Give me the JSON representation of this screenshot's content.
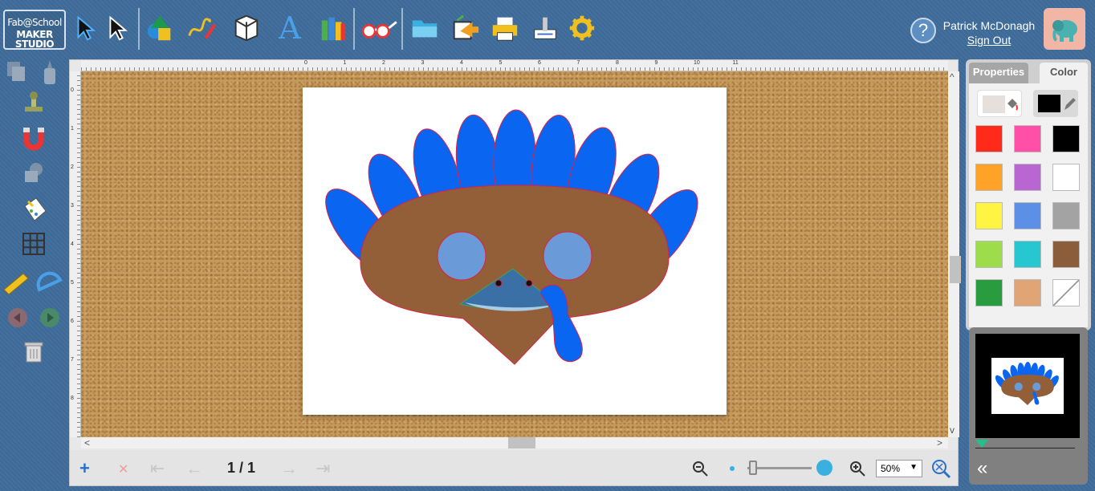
{
  "app": {
    "logo_line1": "Fab@School",
    "logo_line2": "MAKER STUDIO"
  },
  "toolbar": {
    "tools": [
      {
        "name": "select-tool",
        "icon": "arrow-cursor-icon"
      },
      {
        "name": "direct-select-tool",
        "icon": "arrow-outline-icon"
      },
      {
        "name": "shapes-tool",
        "icon": "shapes-icon"
      },
      {
        "name": "draw-tool",
        "icon": "pencil-line-icon"
      },
      {
        "name": "3d-tool",
        "icon": "3d-box-icon"
      },
      {
        "name": "text-tool",
        "icon": "letter-a-icon"
      },
      {
        "name": "library-tool",
        "icon": "books-icon"
      },
      {
        "name": "glasses-tool",
        "icon": "glasses-icon"
      },
      {
        "name": "open-tool",
        "icon": "folder-icon"
      },
      {
        "name": "export-tool",
        "icon": "export-icon"
      },
      {
        "name": "print-tool",
        "icon": "printer-icon"
      },
      {
        "name": "cutter-tool",
        "icon": "cutter-icon"
      },
      {
        "name": "settings-tool",
        "icon": "gear-icon"
      }
    ],
    "text_tool_glyph": "A"
  },
  "user": {
    "name": "Patrick McDonagh",
    "sign_out": "Sign Out",
    "help_glyph": "?"
  },
  "ruler_top": [
    "0",
    "1",
    "2",
    "3",
    "4",
    "5",
    "6",
    "7",
    "8",
    "9",
    "10",
    "11"
  ],
  "ruler_left": [
    "0",
    "1",
    "2",
    "3",
    "4",
    "5",
    "6",
    "7",
    "8"
  ],
  "navigation": {
    "page_info": "1 / 1",
    "add_glyph": "+",
    "delete_glyph": "✕",
    "first_glyph": "⇤",
    "prev_glyph": "←",
    "next_glyph": "→",
    "last_glyph": "⇥"
  },
  "zoom": {
    "value": "50%",
    "level": 0.05
  },
  "panel": {
    "tab_properties": "Properties",
    "tab_color": "Color",
    "fill_color": "#e6e0dd",
    "stroke_color": "#000000",
    "swatches": [
      "#ff2a1a",
      "#ff4fa7",
      "#000000",
      "#ffa328",
      "#b966d2",
      "#ffffff",
      "#fff442",
      "#5c8fe6",
      "#a3a3a3",
      "#9ddd4c",
      "#27c7d1",
      "#8b5d3b",
      "#299c3f",
      "#e1a475",
      "none"
    ]
  },
  "colors": {
    "feather": "#0a66f0",
    "face": "#935f39",
    "eye": "#6a9bd8",
    "beak": "#3a70a6",
    "outline": "#e12040"
  },
  "minimap": {
    "collapse_glyph": "«"
  }
}
